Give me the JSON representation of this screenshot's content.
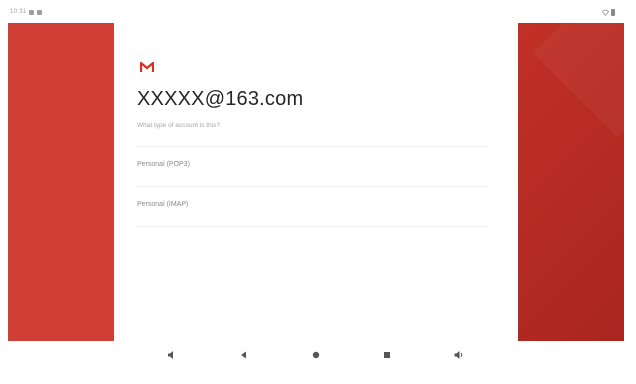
{
  "status_bar": {
    "time": "10:31",
    "left_icons": [
      "notification-icon",
      "sd-card-icon"
    ],
    "right_icons": [
      "wifi-icon",
      "battery-icon"
    ]
  },
  "colors": {
    "side_panel_left": "#cf3f35",
    "side_panel_right": "#b32a22",
    "gmail_red": "#d93025"
  },
  "account_setup": {
    "logo_icon": "gmail-logo-icon",
    "email": "XXXXX@163.com",
    "question": "What type of account is this?",
    "options": [
      {
        "label": "Personal (POP3)"
      },
      {
        "label": "Personal (IMAP)"
      }
    ]
  },
  "nav_bar": {
    "buttons": [
      "volume-down-icon",
      "back-icon",
      "home-icon",
      "recents-icon",
      "volume-up-icon"
    ]
  }
}
